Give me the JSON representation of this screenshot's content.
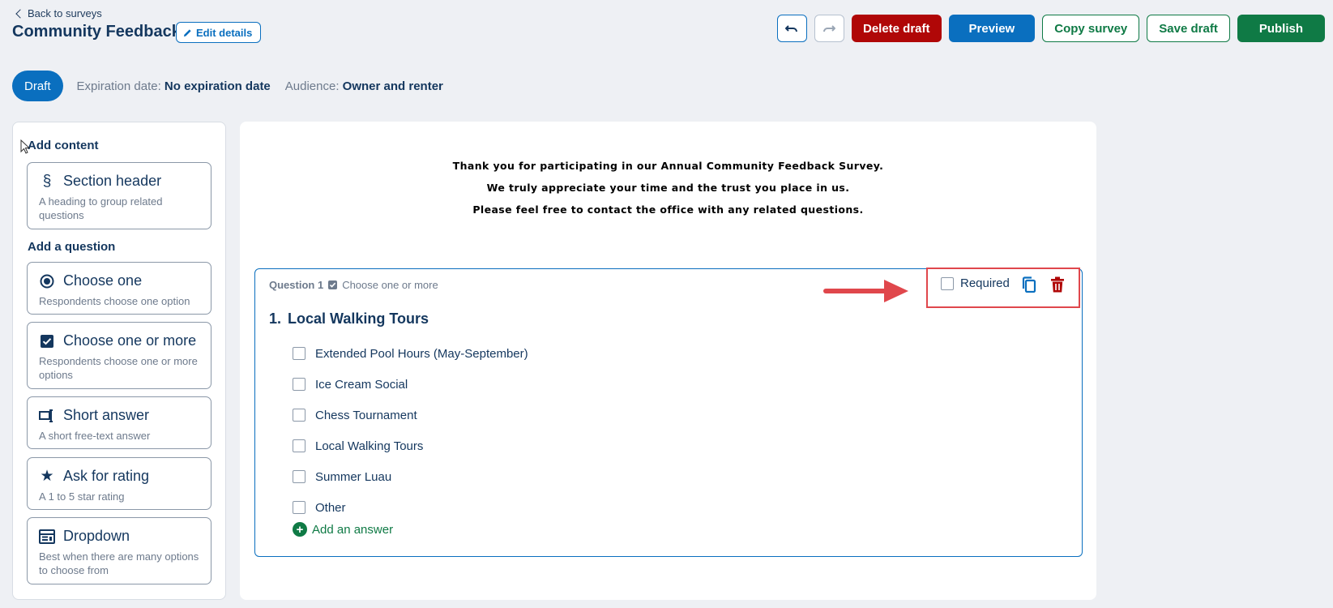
{
  "header": {
    "back_label": "Back to surveys",
    "title": "Community Feedback",
    "edit_label": "Edit details"
  },
  "toolbar": {
    "undo_icon": "undo-icon",
    "redo_icon": "redo-icon",
    "delete_label": "Delete draft",
    "preview_label": "Preview",
    "copy_label": "Copy survey",
    "save_label": "Save draft",
    "publish_label": "Publish"
  },
  "status": {
    "badge": "Draft",
    "expiration_label": "Expiration date:",
    "expiration_value": "No expiration date",
    "audience_label": "Audience:",
    "audience_value": "Owner and renter"
  },
  "sidebar": {
    "content_heading": "Add content",
    "question_heading": "Add a question",
    "items": [
      {
        "title": "Section header",
        "desc": "A heading to group related questions",
        "icon": "section-icon"
      },
      {
        "title": "Choose one",
        "desc": "Respondents choose one option",
        "icon": "radio-icon"
      },
      {
        "title": "Choose one or more",
        "desc": "Respondents choose one or more options",
        "icon": "checkbox-icon"
      },
      {
        "title": "Short answer",
        "desc": "A short free-text answer",
        "icon": "text-input-icon"
      },
      {
        "title": "Ask for rating",
        "desc": "A 1 to 5 star rating",
        "icon": "star-icon"
      },
      {
        "title": "Dropdown",
        "desc": "Best when there are many options to choose from",
        "icon": "dropdown-icon"
      }
    ]
  },
  "intro": {
    "lines": [
      "Thank you for participating in our Annual Community Feedback Survey.",
      "We truly appreciate your time and the trust you place in us.",
      "Please feel free to contact the office with any related questions."
    ]
  },
  "question": {
    "label": "Question 1",
    "type": "Choose one or more",
    "number": "1.",
    "title": "Local Walking Tours",
    "required_label": "Required",
    "answers": [
      "Extended Pool Hours (May-September)",
      "Ice Cream Social",
      "Chess Tournament",
      "Local Walking Tours",
      "Summer Luau",
      "Other"
    ],
    "add_answer_label": "Add an answer"
  },
  "colors": {
    "primary": "#0a6fbf",
    "danger": "#b00707",
    "success": "#0f7a45",
    "annotation": "#e0474c",
    "text": "#14375e"
  }
}
